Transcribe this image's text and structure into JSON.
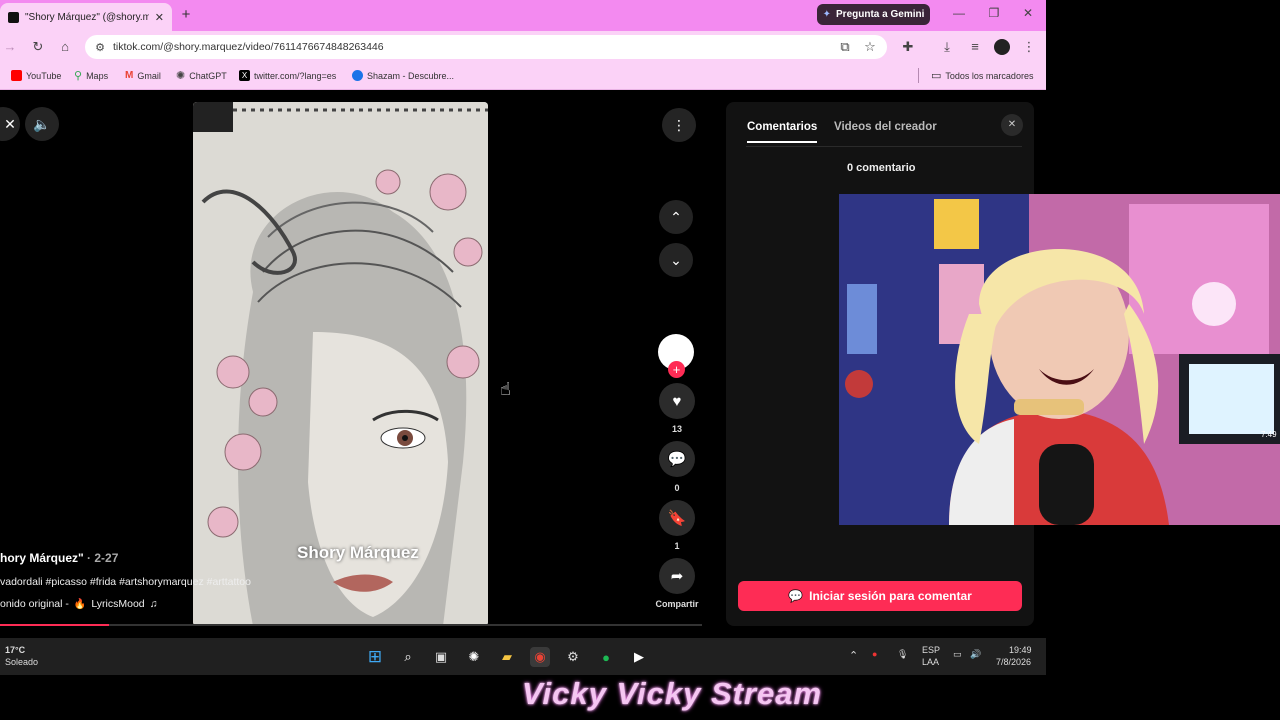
{
  "browser": {
    "tab_title": "\"Shory Márquez\" (@shory.marq",
    "gemini_label": "Pregunta a Gemini",
    "url": "tiktok.com/@shory.marquez/video/7611476674848263446",
    "bookmarks": [
      {
        "label": "YouTube",
        "color": "#ff0000"
      },
      {
        "label": "Maps",
        "color": "#34a853"
      },
      {
        "label": "Gmail",
        "color": "#ea4335"
      },
      {
        "label": "ChatGPT",
        "color": "#444444"
      },
      {
        "label": "twitter.com/?lang=es",
        "color": "#000000"
      },
      {
        "label": "Shazam - Descubre...",
        "color": "#1a73e8"
      }
    ],
    "all_bookmarks": "Todos los marcadores"
  },
  "video": {
    "watermark": "Shory Márquez",
    "author": "hory Márquez\"",
    "date": " · 2-27",
    "description": "vadordali #picasso #frida #artshorymarquez #arttattoo",
    "sound": "onido original - ",
    "sound_artist": "LyricsMood",
    "progress": 0.155
  },
  "actions": {
    "likes": "13",
    "comments": "0",
    "saves": "1",
    "share_label": "Compartir"
  },
  "comments_panel": {
    "tab_comments": "Comentarios",
    "tab_creator_videos": "Videos del creador",
    "count_text": "0 comentario",
    "login_button": "Iniciar sesión para comentar"
  },
  "webcam": {
    "screen_time": "7:49"
  },
  "taskbar": {
    "weather_temp": "17°C",
    "weather_desc": "Soleado",
    "lang_top": "ESP",
    "lang_bottom": "LAA",
    "time": "19:49",
    "date": "7/8/2026"
  },
  "overlay": {
    "stream_name": "Vicky Vicky Stream"
  }
}
